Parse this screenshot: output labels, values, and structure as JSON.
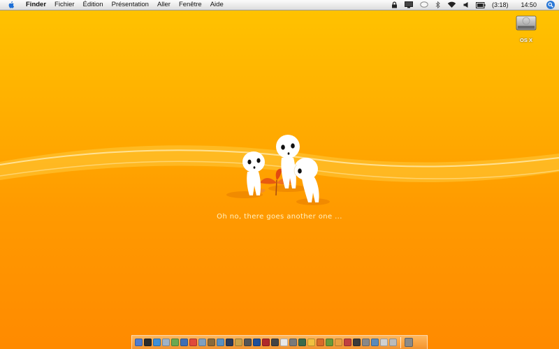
{
  "menubar": {
    "apple_icon": "apple-icon",
    "app_name": "Finder",
    "items": [
      "Fichier",
      "Édition",
      "Présentation",
      "Aller",
      "Fenêtre",
      "Aide"
    ],
    "battery_time": "(3:18)",
    "clock": "14:50"
  },
  "desktop": {
    "drive_label": "OS X"
  },
  "wallpaper": {
    "caption": "Oh no, there goes another one ..."
  },
  "dock": {
    "icons": [
      {
        "name": "finder-icon",
        "color": "#4f7ccf"
      },
      {
        "name": "dashboard-icon",
        "color": "#2b2b2b"
      },
      {
        "name": "safari-icon",
        "color": "#3d8fd8"
      },
      {
        "name": "mail-icon",
        "color": "#9fb3c8"
      },
      {
        "name": "ichat-icon",
        "color": "#6aa84f"
      },
      {
        "name": "itunes-icon",
        "color": "#3f6fb5"
      },
      {
        "name": "ical-icon",
        "color": "#e04a3a"
      },
      {
        "name": "preview-icon",
        "color": "#7fa0c0"
      },
      {
        "name": "address-book-icon",
        "color": "#8a6a3a"
      },
      {
        "name": "iphoto-icon",
        "color": "#5a8fbf"
      },
      {
        "name": "imovie-icon",
        "color": "#2a3a5a"
      },
      {
        "name": "garageband-icon",
        "color": "#c9a24a"
      },
      {
        "name": "idvd-icon",
        "color": "#555555"
      },
      {
        "name": "photoshop-icon",
        "color": "#1f4f99"
      },
      {
        "name": "flash-icon",
        "color": "#b0282a"
      },
      {
        "name": "bridge-icon",
        "color": "#444444"
      },
      {
        "name": "textedit-icon",
        "color": "#e8e8e8"
      },
      {
        "name": "system-prefs-icon",
        "color": "#7a7a7a"
      },
      {
        "name": "dreamweaver-icon",
        "color": "#3a6a4a"
      },
      {
        "name": "app-1-icon",
        "color": "#f0c040"
      },
      {
        "name": "app-2-icon",
        "color": "#d86a2a"
      },
      {
        "name": "app-3-icon",
        "color": "#6a9a3a"
      },
      {
        "name": "app-4-icon",
        "color": "#e8a040"
      },
      {
        "name": "app-5-icon",
        "color": "#c04040"
      },
      {
        "name": "app-6-icon",
        "color": "#3a3a3a"
      },
      {
        "name": "app-7-icon",
        "color": "#888888"
      },
      {
        "name": "app-8-icon",
        "color": "#5a8aba"
      },
      {
        "name": "app-9-icon",
        "color": "#d0d0d0"
      },
      {
        "name": "app-10-icon",
        "color": "#bbbbbb"
      }
    ],
    "trash_icon": {
      "name": "trash-icon",
      "color": "#8a8a8a"
    }
  }
}
